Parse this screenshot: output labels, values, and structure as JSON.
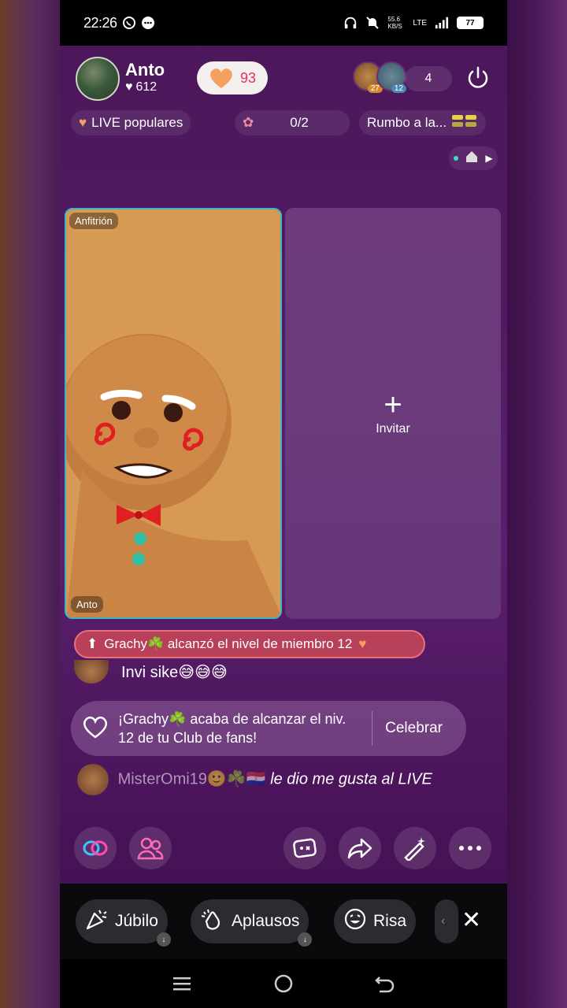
{
  "status_bar": {
    "time": "22:26",
    "net_speed": "55.6 KB/S",
    "network": "LTE",
    "battery": "77"
  },
  "header": {
    "host_name": "Anto",
    "host_likes": "612",
    "heart_count": "93",
    "viewer_levels": [
      "27",
      "12"
    ],
    "viewer_count": "4"
  },
  "subbar": {
    "popular_label": "LIVE populares",
    "goal_progress": "0/2",
    "rumbo_label": "Rumbo a la..."
  },
  "stage": {
    "host_tag": "Anfitrión",
    "host_name_tag": "Anto",
    "invite_label": "Invitar"
  },
  "chat": {
    "member_banner": "Grachy☘️ alcanzó el nivel de miembro 12",
    "invi_message": "Invi sike😅😅😅",
    "fan_banner_text": "¡Grachy☘️ acaba de alcanzar el niv. 12 de tu Club de fans!",
    "celebrate_label": "Celebrar",
    "like_user": "MisterOmi19🙂☘️🇵🇾",
    "like_message": "le dio me gusta al LIVE"
  },
  "reactions": {
    "items": [
      "Júbilo",
      "Aplausos",
      "Risa"
    ]
  },
  "colors": {
    "accent_pink": "#e8305a",
    "host_border": "#3bb6c9",
    "banner_red": "#b84058"
  },
  "icons": {
    "power": "power-icon",
    "link": "link-icon",
    "people": "people-icon",
    "share": "share-icon",
    "magic": "magic-wand-icon",
    "more": "more-icon"
  }
}
